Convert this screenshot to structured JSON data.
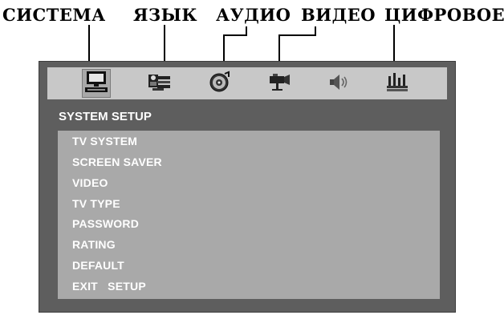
{
  "captions": [
    "СИСТЕМА",
    "ЯЗЫК",
    "АУДИО",
    "ВИДЕО",
    "ЦИФРОВОЕ"
  ],
  "tabs": [
    {
      "icon": "monitor-icon",
      "active": true
    },
    {
      "icon": "language-icon",
      "active": false
    },
    {
      "icon": "audio-disc-icon",
      "active": false
    },
    {
      "icon": "video-camera-icon",
      "active": false
    },
    {
      "icon": "speaker-icon",
      "active": false
    },
    {
      "icon": "digital-settings-icon",
      "active": false
    }
  ],
  "setup": {
    "title": "SYSTEM SETUP",
    "items": [
      "TV SYSTEM",
      "SCREEN SAVER",
      "VIDEO",
      "TV TYPE",
      "PASSWORD",
      "RATING",
      "DEFAULT",
      "EXIT   SETUP"
    ]
  },
  "colors": {
    "osd_background": "#5e5e5e",
    "icon_bar": "#c8c8c8",
    "menu_panel": "#a9a9a9",
    "menu_text": "#ffffff"
  }
}
